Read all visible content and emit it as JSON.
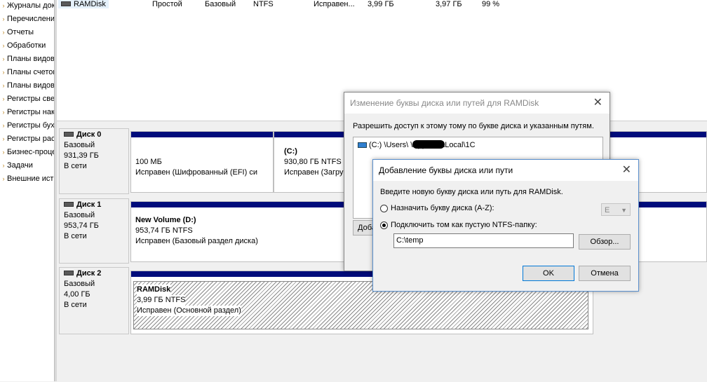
{
  "tree": {
    "items": [
      "Журналы док",
      "Перечислени",
      "Отчеты",
      "Обработки",
      "Планы видов",
      "Планы счетов",
      "Планы видов",
      "Регистры све",
      "Регистры нак",
      "Регистры бух",
      "Регистры рас",
      "Бизнес-проце",
      "Задачи",
      "Внешние ист"
    ]
  },
  "volume_row": {
    "name": "RAMDisk",
    "layout": "Простой",
    "type": "Базовый",
    "fs": "NTFS",
    "status": "Исправен...",
    "capacity": "3,99 ГБ",
    "free": "3,97 ГБ",
    "free_pct": "99 %"
  },
  "disks": [
    {
      "title": "Диск 0",
      "kind": "Базовый",
      "size": "931,39 ГБ",
      "state": "В сети",
      "partitions": [
        {
          "name": "",
          "size": "100 МБ",
          "status": "Исправен (Шифрованный (EFI) си"
        },
        {
          "name": "(C:)",
          "size": "930,80 ГБ NTFS",
          "status": "Исправен (Загру"
        }
      ]
    },
    {
      "title": "Диск 1",
      "kind": "Базовый",
      "size": "953,74 ГБ",
      "state": "В сети",
      "partitions": [
        {
          "name": "New Volume  (D:)",
          "size": "953,74 ГБ NTFS",
          "status": "Исправен (Базовый раздел диска)"
        }
      ]
    },
    {
      "title": "Диск 2",
      "kind": "Базовый",
      "size": "4,00 ГБ",
      "state": "В сети",
      "partitions": [
        {
          "name": "RAMDisk",
          "size": "3,99 ГБ NTFS",
          "status": "Исправен (Основной раздел)"
        }
      ]
    }
  ],
  "dialog_paths": {
    "title": "Изменение буквы диска или путей для RAMDisk",
    "description": "Разрешить доступ к этому тому по букве диска и указанным путям.",
    "path_item": "(C:) \\Users\\        \\AppData\\Local\\1C",
    "add_button": "Доба"
  },
  "dialog_add": {
    "title": "Добавление буквы диска или пути",
    "prompt": "Введите новую букву диска или путь для RAMDisk.",
    "radio_letter": "Назначить букву диска (A-Z):",
    "letter_value": "E",
    "radio_folder": "Подключить том как пустую NTFS-папку:",
    "folder_value": "C:\\temp",
    "browse": "Обзор...",
    "ok": "OK",
    "cancel": "Отмена"
  },
  "colors": {
    "partition_bar": "#000c7b",
    "focus": "#0078d7"
  }
}
